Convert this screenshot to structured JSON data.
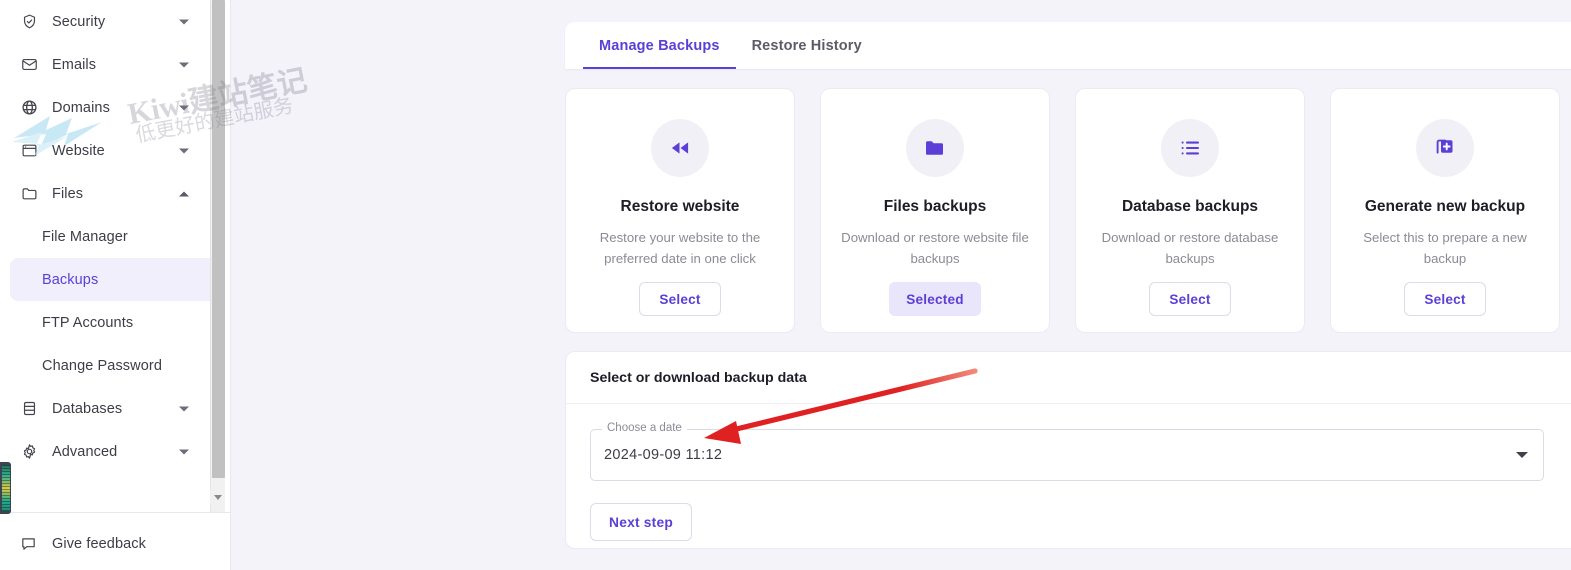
{
  "sidebar": {
    "items": [
      {
        "label": "Security",
        "icon": "shield-check-icon",
        "expandable": true,
        "expanded": false
      },
      {
        "label": "Emails",
        "icon": "envelope-icon",
        "expandable": true,
        "expanded": false
      },
      {
        "label": "Domains",
        "icon": "globe-icon",
        "expandable": true,
        "expanded": false
      },
      {
        "label": "Website",
        "icon": "browser-icon",
        "expandable": true,
        "expanded": false
      },
      {
        "label": "Files",
        "icon": "folder-icon",
        "expandable": true,
        "expanded": true
      }
    ],
    "files_subitems": [
      {
        "label": "File Manager",
        "active": false
      },
      {
        "label": "Backups",
        "active": true
      },
      {
        "label": "FTP Accounts",
        "active": false
      },
      {
        "label": "Change Password",
        "active": false
      }
    ],
    "items_after": [
      {
        "label": "Databases",
        "icon": "database-icon",
        "expandable": true,
        "expanded": false
      },
      {
        "label": "Advanced",
        "icon": "gear-icon",
        "expandable": true,
        "expanded": false
      }
    ],
    "feedback": {
      "label": "Give feedback",
      "icon": "chat-bubble-icon"
    }
  },
  "watermark": {
    "line1": "Kiwi建站笔记",
    "line2": "低更好的建站服务"
  },
  "tabs": [
    {
      "label": "Manage Backups",
      "active": true
    },
    {
      "label": "Restore History",
      "active": false
    }
  ],
  "cards": [
    {
      "title": "Restore website",
      "desc": "Restore your website to the preferred date in one click",
      "button": "Select",
      "selected": false,
      "icon": "rewind-icon"
    },
    {
      "title": "Files backups",
      "desc": "Download or restore website file backups",
      "button": "Selected",
      "selected": true,
      "icon": "folder-filled-icon"
    },
    {
      "title": "Database backups",
      "desc": "Download or restore database backups",
      "button": "Select",
      "selected": false,
      "icon": "list-icon"
    },
    {
      "title": "Generate new backup",
      "desc": "Select this to prepare a new backup",
      "button": "Select",
      "selected": false,
      "icon": "add-copy-icon"
    }
  ],
  "panel": {
    "title": "Select or download backup data",
    "date_field": {
      "legend": "Choose a date",
      "value": "2024-09-09 11:12",
      "caret": "chevron-down-icon"
    },
    "next_button": "Next step"
  },
  "colors": {
    "accent": "#5b3fd6",
    "accent_soft": "#e9e5fb",
    "page_bg": "#f4f3fa",
    "card_bg": "#ffffff",
    "text": "#1d1d27",
    "muted": "#8a8b96",
    "annotation": "#e02121"
  }
}
